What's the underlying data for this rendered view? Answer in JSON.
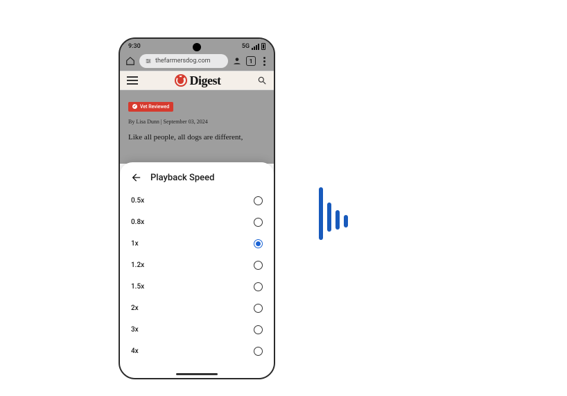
{
  "status": {
    "time": "9:30",
    "network": "5G"
  },
  "urlbar": {
    "domain": "thefarmersdog.com",
    "tab_count": "1"
  },
  "brand": {
    "name": "Digest"
  },
  "article": {
    "badge": "Vet Reviewed",
    "byline": "By Lisa Dunn | September 03, 2024",
    "body": "Like all people, all dogs are different,"
  },
  "sheet": {
    "title": "Playback Speed",
    "selected": "1x",
    "options": [
      {
        "label": "0.5x"
      },
      {
        "label": "0.8x"
      },
      {
        "label": "1x"
      },
      {
        "label": "1.2x"
      },
      {
        "label": "1.5x"
      },
      {
        "label": "2x"
      },
      {
        "label": "3x"
      },
      {
        "label": "4x"
      }
    ]
  }
}
